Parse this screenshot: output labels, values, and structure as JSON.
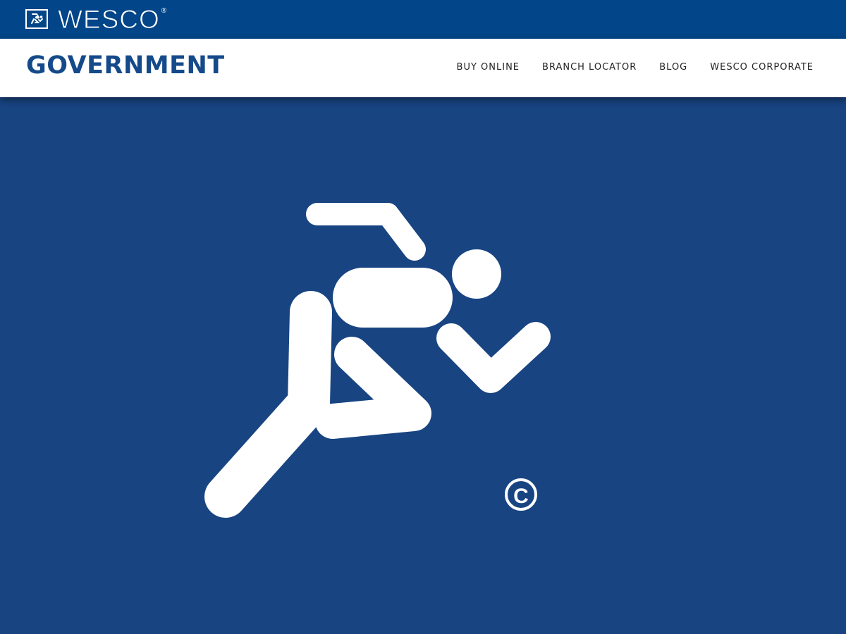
{
  "header": {
    "brand": "WESCO",
    "brand_registered": "®",
    "logo_icon": "running-man-icon"
  },
  "nav": {
    "site_title": "GOVERNMENT",
    "links": [
      {
        "label": "BUY ONLINE"
      },
      {
        "label": "BRANCH LOCATOR"
      },
      {
        "label": "BLOG"
      },
      {
        "label": "WESCO CORPORATE"
      }
    ]
  },
  "hero": {
    "logo_icon": "running-man-icon",
    "copyright_symbol": "©"
  },
  "colors": {
    "top_bar": "#024588",
    "hero_background": "#184482",
    "title": "#144a8a",
    "nav_text": "#222222",
    "logo": "#ffffff"
  }
}
